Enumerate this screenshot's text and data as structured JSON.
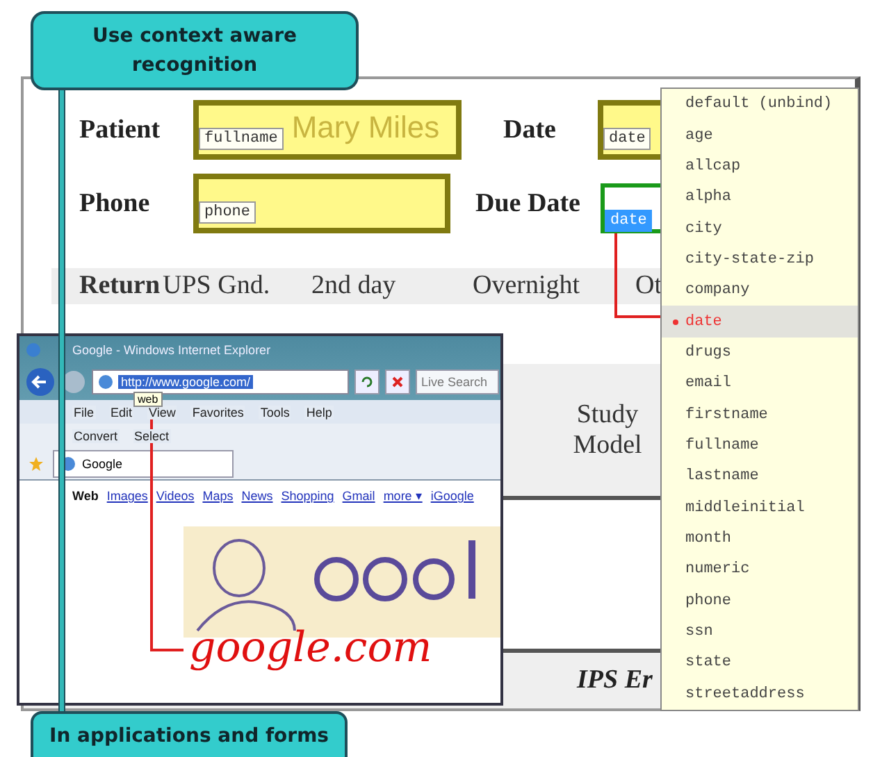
{
  "callouts": [
    {
      "text": "Use context aware recognition",
      "kind": "top"
    },
    {
      "text": "In applications and forms",
      "kind": "bottom"
    }
  ],
  "form": {
    "rows": [
      {
        "fields": [
          {
            "label": "Patient",
            "value": "Mary Miles",
            "tag": "fullname",
            "active": false
          },
          {
            "label": "Date",
            "tag": "date",
            "active": false
          }
        ]
      },
      {
        "fields": [
          {
            "label": "Phone",
            "tag": "phone",
            "active": false
          },
          {
            "label": "Due Date",
            "tag": "date",
            "active": true
          }
        ]
      }
    ],
    "shipping": {
      "label": "Return",
      "options": [
        "UPS Gnd.",
        "2nd day",
        "Overnight",
        "Ot"
      ]
    },
    "table": {
      "header": "Study Model",
      "footer": "IPS Er"
    }
  },
  "dropdown": {
    "items": [
      {
        "label": "default (unbind)",
        "selected": false
      },
      {
        "label": "age",
        "selected": false
      },
      {
        "label": "allcap",
        "selected": false
      },
      {
        "label": "alpha",
        "selected": false
      },
      {
        "label": "city",
        "selected": false
      },
      {
        "label": "city-state-zip",
        "selected": false
      },
      {
        "label": "company",
        "selected": false
      },
      {
        "label": "date",
        "selected": true
      },
      {
        "label": "drugs",
        "selected": false
      },
      {
        "label": "email",
        "selected": false
      },
      {
        "label": "firstname",
        "selected": false
      },
      {
        "label": "fullname",
        "selected": false
      },
      {
        "label": "lastname",
        "selected": false
      },
      {
        "label": "middleinitial",
        "selected": false
      },
      {
        "label": "month",
        "selected": false
      },
      {
        "label": "numeric",
        "selected": false
      },
      {
        "label": "phone",
        "selected": false
      },
      {
        "label": "ssn",
        "selected": false
      },
      {
        "label": "state",
        "selected": false
      },
      {
        "label": "streetaddress",
        "selected": false
      }
    ]
  },
  "browser": {
    "title": "Google - Windows Internet Explorer",
    "address": "http://www.google.com/",
    "search_placeholder": "Live Search",
    "tooltip": "web",
    "menu": [
      "File",
      "Edit",
      "View",
      "Favorites",
      "Tools",
      "Help"
    ],
    "toolbar": [
      "Convert",
      "Select"
    ],
    "tab": "Google",
    "links": [
      {
        "label": "Web",
        "kind": "text"
      },
      {
        "label": "Images",
        "kind": "link"
      },
      {
        "label": "Videos",
        "kind": "link"
      },
      {
        "label": "Maps",
        "kind": "link"
      },
      {
        "label": "News",
        "kind": "link"
      },
      {
        "label": "Shopping",
        "kind": "link"
      },
      {
        "label": "Gmail",
        "kind": "link"
      },
      {
        "label": "more ▾",
        "kind": "link"
      },
      {
        "label": "iGoogle",
        "kind": "link"
      }
    ],
    "handwriting": "google.com"
  }
}
